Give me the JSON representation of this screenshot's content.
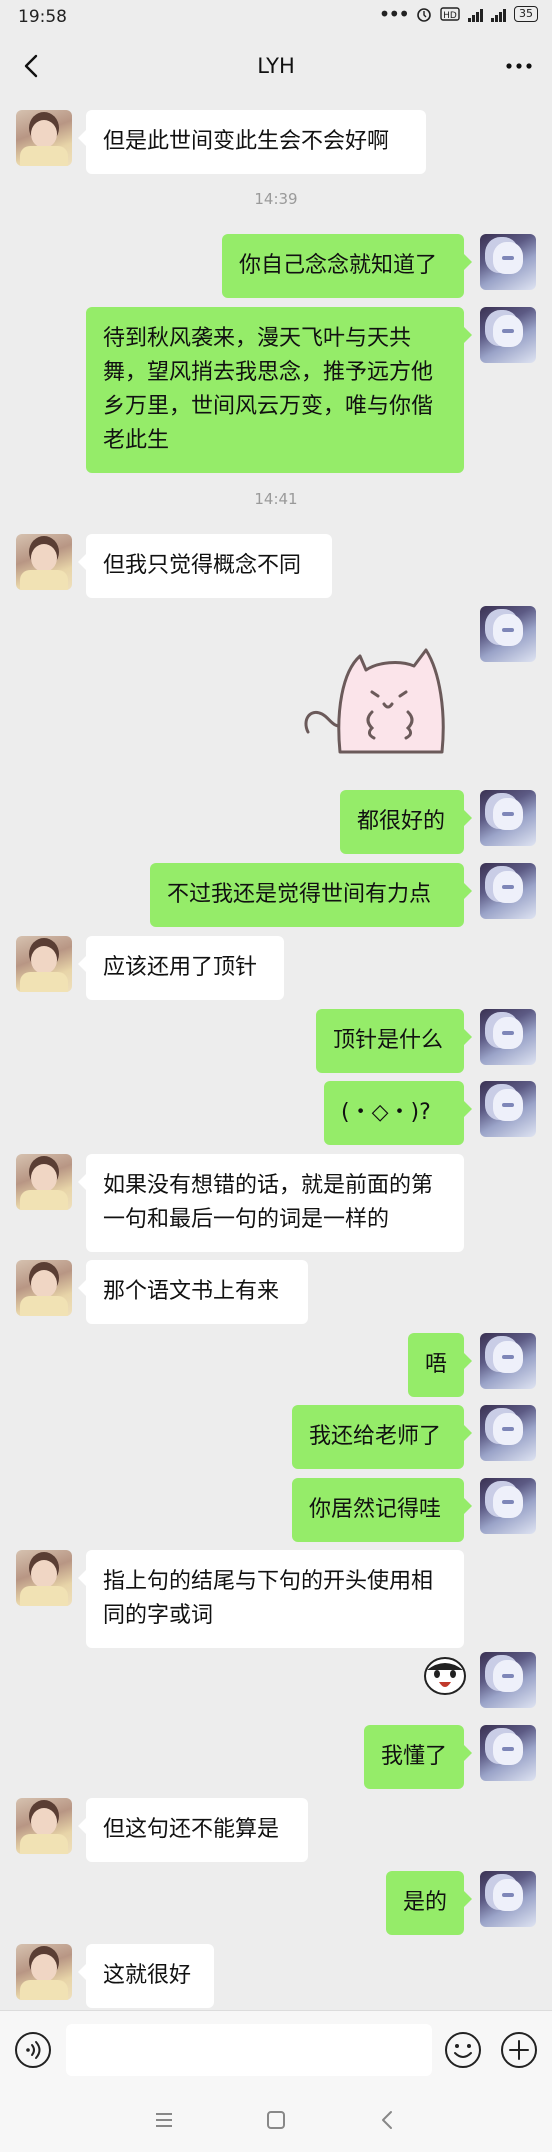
{
  "status_bar": {
    "time": "19:58",
    "battery": "35"
  },
  "header": {
    "title": "LYH"
  },
  "messages": {
    "m1": "但是此世间变此生会不会好啊",
    "m2": "你自己念念就知道了",
    "m3": "待到秋风袭来，漫天飞叶与天共舞，望风捎去我思念，推予远方他乡万里，世间风云万变，唯与你偕老此生",
    "m4": "但我只觉得概念不同",
    "m5": "都很好的",
    "m6": "不过我还是觉得世间有力点",
    "m7": "应该还用了顶针",
    "m8": "顶针是什么",
    "m9": "(・◇・)?",
    "m10": "如果没有想错的话，就是前面的第一句和最后一句的词是一样的",
    "m11": "那个语文书上有来",
    "m12": "唔",
    "m13": "我还给老师了",
    "m14": "你居然记得哇",
    "m15": "指上句的结尾与下句的开头使用相同的字或词",
    "m16": "我懂了",
    "m17": "但这句还不能算是",
    "m18": "是的",
    "m19": "这就很好"
  },
  "timestamps": {
    "t1": "14:39",
    "t2": "14:41"
  },
  "icons": {
    "back": "back-arrow-icon",
    "more": "more-dots-icon",
    "voice": "voice-icon",
    "emoji": "emoji-icon",
    "plus": "plus-icon"
  },
  "colors": {
    "bubble_self": "#95ec69",
    "bubble_other": "#ffffff",
    "background": "#ededed"
  }
}
